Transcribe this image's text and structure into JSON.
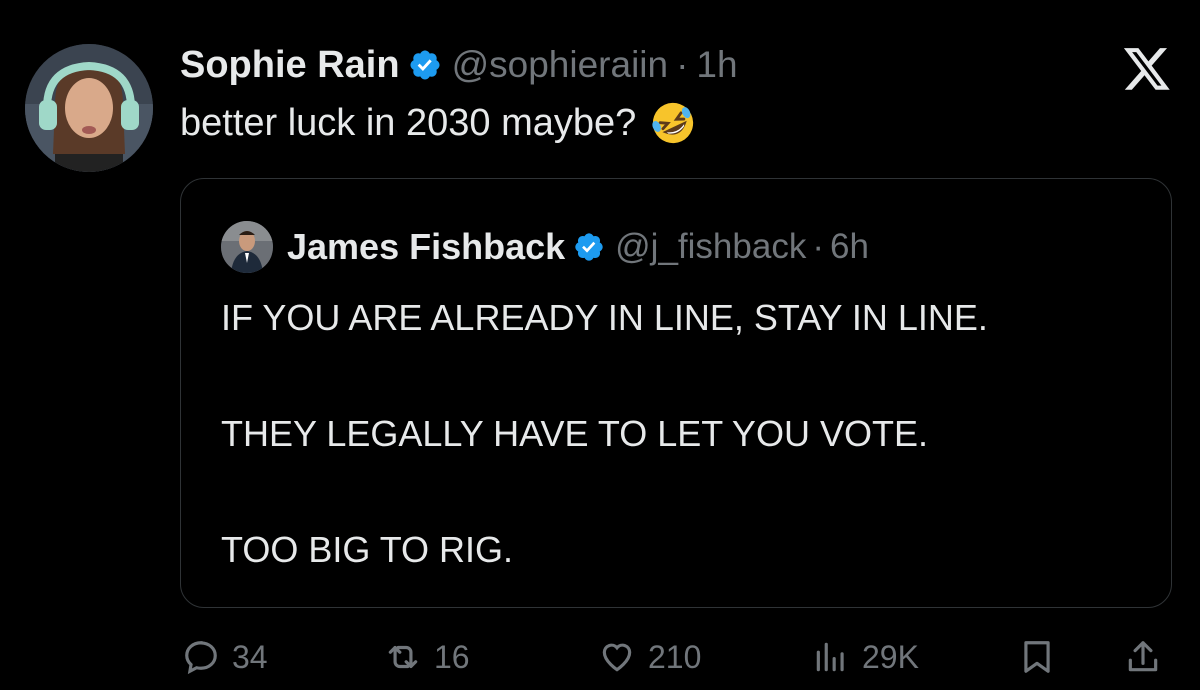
{
  "tweet": {
    "author_name": "Sophie Rain",
    "author_handle": "@sophieraiin",
    "separator": "·",
    "time": "1h",
    "text": "better luck in 2030 maybe?",
    "emoji": "rolling-on-floor-laughing"
  },
  "quoted": {
    "author_name": "James Fishback",
    "author_handle": "@j_fishback",
    "separator": "·",
    "time": "6h",
    "lines": [
      "IF YOU ARE ALREADY IN LINE, STAY IN LINE.",
      "THEY LEGALLY HAVE TO LET YOU VOTE.",
      "TOO BIG TO RIG."
    ]
  },
  "actions": {
    "replies": "34",
    "reposts": "16",
    "likes": "210",
    "views": "29K"
  },
  "colors": {
    "background": "#000000",
    "text": "#e7e9ea",
    "muted": "#71767b",
    "verified": "#1d9bf0",
    "border": "#2f3336"
  }
}
